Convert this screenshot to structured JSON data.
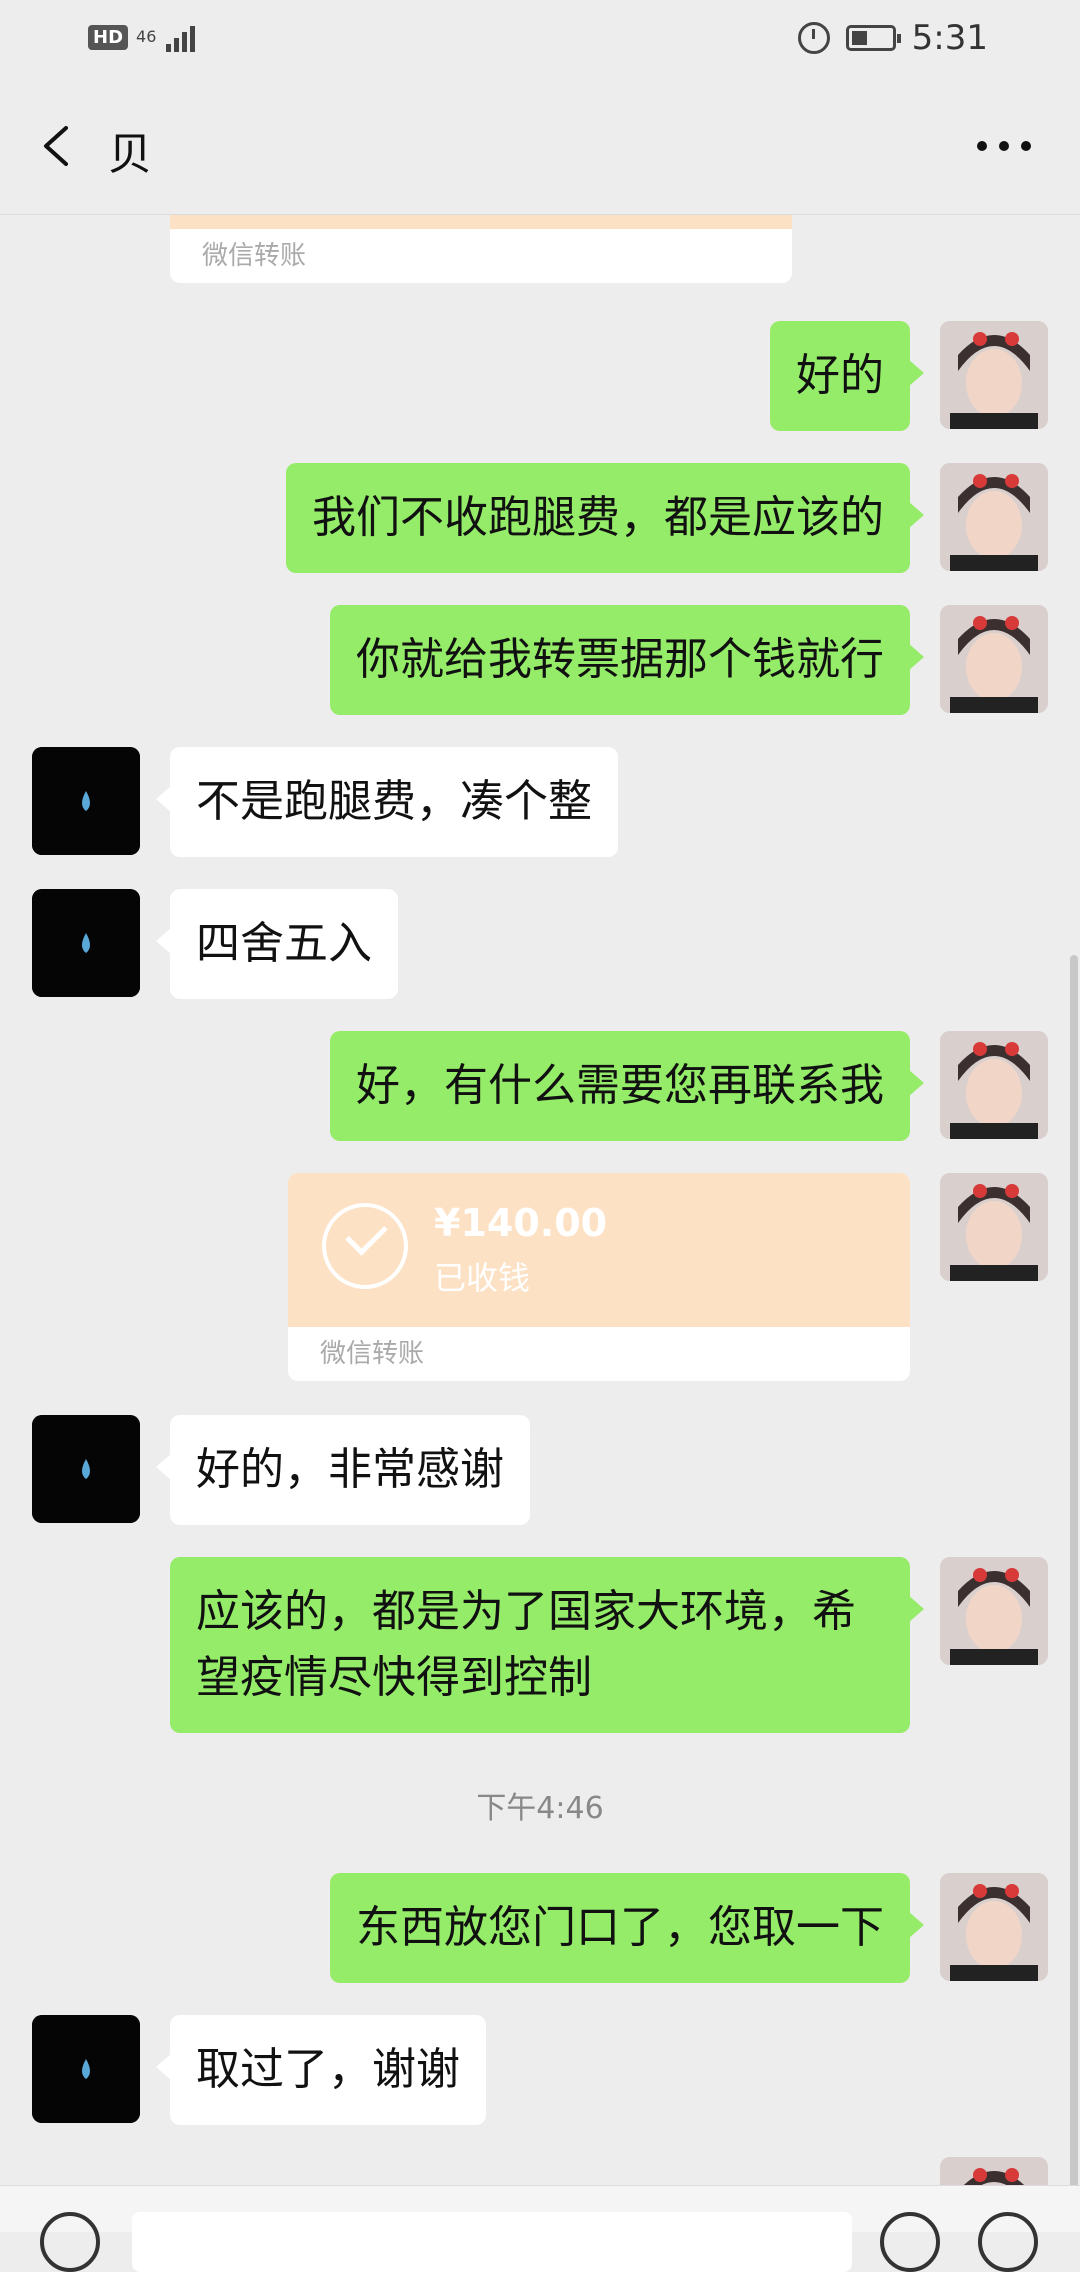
{
  "status_bar": {
    "hd": "HD",
    "network": "46",
    "time": "5:31",
    "battery_level": 0.4
  },
  "header": {
    "title": "贝",
    "back_icon": "chevron-left-icon",
    "more_icon": "more-dots-icon"
  },
  "transfer_label": "微信转账",
  "messages": [
    {
      "from": "me",
      "text": "好的"
    },
    {
      "from": "me",
      "text": "我们不收跑腿费，都是应该的"
    },
    {
      "from": "me",
      "text": "你就给我转票据那个钱就行"
    },
    {
      "from": "other",
      "text": "不是跑腿费，凑个整"
    },
    {
      "from": "other",
      "text": "四舍五入"
    },
    {
      "from": "me",
      "text": "好，有什么需要您再联系我"
    },
    {
      "from": "me",
      "type": "transfer",
      "amount": "¥140.00",
      "status": "已收钱",
      "label": "微信转账"
    },
    {
      "from": "other",
      "text": "好的，非常感谢"
    },
    {
      "from": "me",
      "text": "应该的，都是为了国家大环境，希望疫情尽快得到控制"
    },
    {
      "from": "me",
      "text": "东西放您门口了，您取一下"
    },
    {
      "from": "other",
      "text": "取过了，谢谢"
    }
  ],
  "timestamp": "下午4:46",
  "colors": {
    "my_bubble": "#95ec69",
    "other_bubble": "#ffffff",
    "background": "#ededed",
    "transfer": "#fde1c4"
  }
}
